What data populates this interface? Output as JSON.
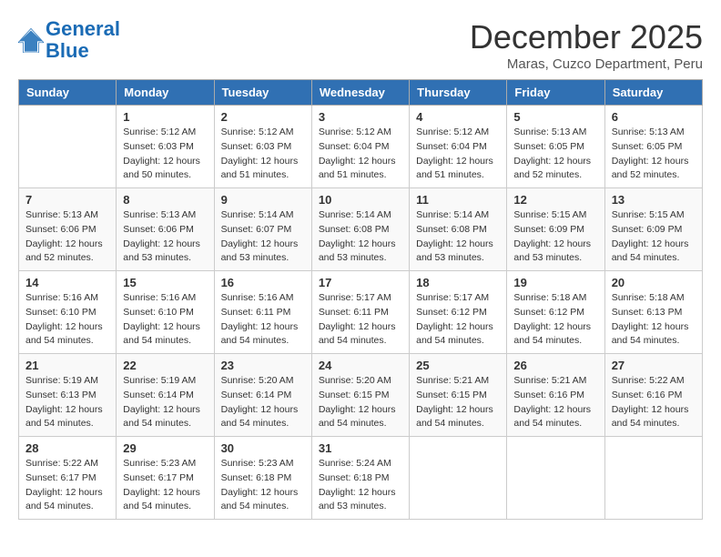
{
  "header": {
    "logo_general": "General",
    "logo_blue": "Blue",
    "month_title": "December 2025",
    "location": "Maras, Cuzco Department, Peru"
  },
  "days_of_week": [
    "Sunday",
    "Monday",
    "Tuesday",
    "Wednesday",
    "Thursday",
    "Friday",
    "Saturday"
  ],
  "weeks": [
    [
      {
        "day": "",
        "info": ""
      },
      {
        "day": "1",
        "info": "Sunrise: 5:12 AM\nSunset: 6:03 PM\nDaylight: 12 hours\nand 50 minutes."
      },
      {
        "day": "2",
        "info": "Sunrise: 5:12 AM\nSunset: 6:03 PM\nDaylight: 12 hours\nand 51 minutes."
      },
      {
        "day": "3",
        "info": "Sunrise: 5:12 AM\nSunset: 6:04 PM\nDaylight: 12 hours\nand 51 minutes."
      },
      {
        "day": "4",
        "info": "Sunrise: 5:12 AM\nSunset: 6:04 PM\nDaylight: 12 hours\nand 51 minutes."
      },
      {
        "day": "5",
        "info": "Sunrise: 5:13 AM\nSunset: 6:05 PM\nDaylight: 12 hours\nand 52 minutes."
      },
      {
        "day": "6",
        "info": "Sunrise: 5:13 AM\nSunset: 6:05 PM\nDaylight: 12 hours\nand 52 minutes."
      }
    ],
    [
      {
        "day": "7",
        "info": "Sunrise: 5:13 AM\nSunset: 6:06 PM\nDaylight: 12 hours\nand 52 minutes."
      },
      {
        "day": "8",
        "info": "Sunrise: 5:13 AM\nSunset: 6:06 PM\nDaylight: 12 hours\nand 53 minutes."
      },
      {
        "day": "9",
        "info": "Sunrise: 5:14 AM\nSunset: 6:07 PM\nDaylight: 12 hours\nand 53 minutes."
      },
      {
        "day": "10",
        "info": "Sunrise: 5:14 AM\nSunset: 6:08 PM\nDaylight: 12 hours\nand 53 minutes."
      },
      {
        "day": "11",
        "info": "Sunrise: 5:14 AM\nSunset: 6:08 PM\nDaylight: 12 hours\nand 53 minutes."
      },
      {
        "day": "12",
        "info": "Sunrise: 5:15 AM\nSunset: 6:09 PM\nDaylight: 12 hours\nand 53 minutes."
      },
      {
        "day": "13",
        "info": "Sunrise: 5:15 AM\nSunset: 6:09 PM\nDaylight: 12 hours\nand 54 minutes."
      }
    ],
    [
      {
        "day": "14",
        "info": "Sunrise: 5:16 AM\nSunset: 6:10 PM\nDaylight: 12 hours\nand 54 minutes."
      },
      {
        "day": "15",
        "info": "Sunrise: 5:16 AM\nSunset: 6:10 PM\nDaylight: 12 hours\nand 54 minutes."
      },
      {
        "day": "16",
        "info": "Sunrise: 5:16 AM\nSunset: 6:11 PM\nDaylight: 12 hours\nand 54 minutes."
      },
      {
        "day": "17",
        "info": "Sunrise: 5:17 AM\nSunset: 6:11 PM\nDaylight: 12 hours\nand 54 minutes."
      },
      {
        "day": "18",
        "info": "Sunrise: 5:17 AM\nSunset: 6:12 PM\nDaylight: 12 hours\nand 54 minutes."
      },
      {
        "day": "19",
        "info": "Sunrise: 5:18 AM\nSunset: 6:12 PM\nDaylight: 12 hours\nand 54 minutes."
      },
      {
        "day": "20",
        "info": "Sunrise: 5:18 AM\nSunset: 6:13 PM\nDaylight: 12 hours\nand 54 minutes."
      }
    ],
    [
      {
        "day": "21",
        "info": "Sunrise: 5:19 AM\nSunset: 6:13 PM\nDaylight: 12 hours\nand 54 minutes."
      },
      {
        "day": "22",
        "info": "Sunrise: 5:19 AM\nSunset: 6:14 PM\nDaylight: 12 hours\nand 54 minutes."
      },
      {
        "day": "23",
        "info": "Sunrise: 5:20 AM\nSunset: 6:14 PM\nDaylight: 12 hours\nand 54 minutes."
      },
      {
        "day": "24",
        "info": "Sunrise: 5:20 AM\nSunset: 6:15 PM\nDaylight: 12 hours\nand 54 minutes."
      },
      {
        "day": "25",
        "info": "Sunrise: 5:21 AM\nSunset: 6:15 PM\nDaylight: 12 hours\nand 54 minutes."
      },
      {
        "day": "26",
        "info": "Sunrise: 5:21 AM\nSunset: 6:16 PM\nDaylight: 12 hours\nand 54 minutes."
      },
      {
        "day": "27",
        "info": "Sunrise: 5:22 AM\nSunset: 6:16 PM\nDaylight: 12 hours\nand 54 minutes."
      }
    ],
    [
      {
        "day": "28",
        "info": "Sunrise: 5:22 AM\nSunset: 6:17 PM\nDaylight: 12 hours\nand 54 minutes."
      },
      {
        "day": "29",
        "info": "Sunrise: 5:23 AM\nSunset: 6:17 PM\nDaylight: 12 hours\nand 54 minutes."
      },
      {
        "day": "30",
        "info": "Sunrise: 5:23 AM\nSunset: 6:18 PM\nDaylight: 12 hours\nand 54 minutes."
      },
      {
        "day": "31",
        "info": "Sunrise: 5:24 AM\nSunset: 6:18 PM\nDaylight: 12 hours\nand 53 minutes."
      },
      {
        "day": "",
        "info": ""
      },
      {
        "day": "",
        "info": ""
      },
      {
        "day": "",
        "info": ""
      }
    ]
  ]
}
